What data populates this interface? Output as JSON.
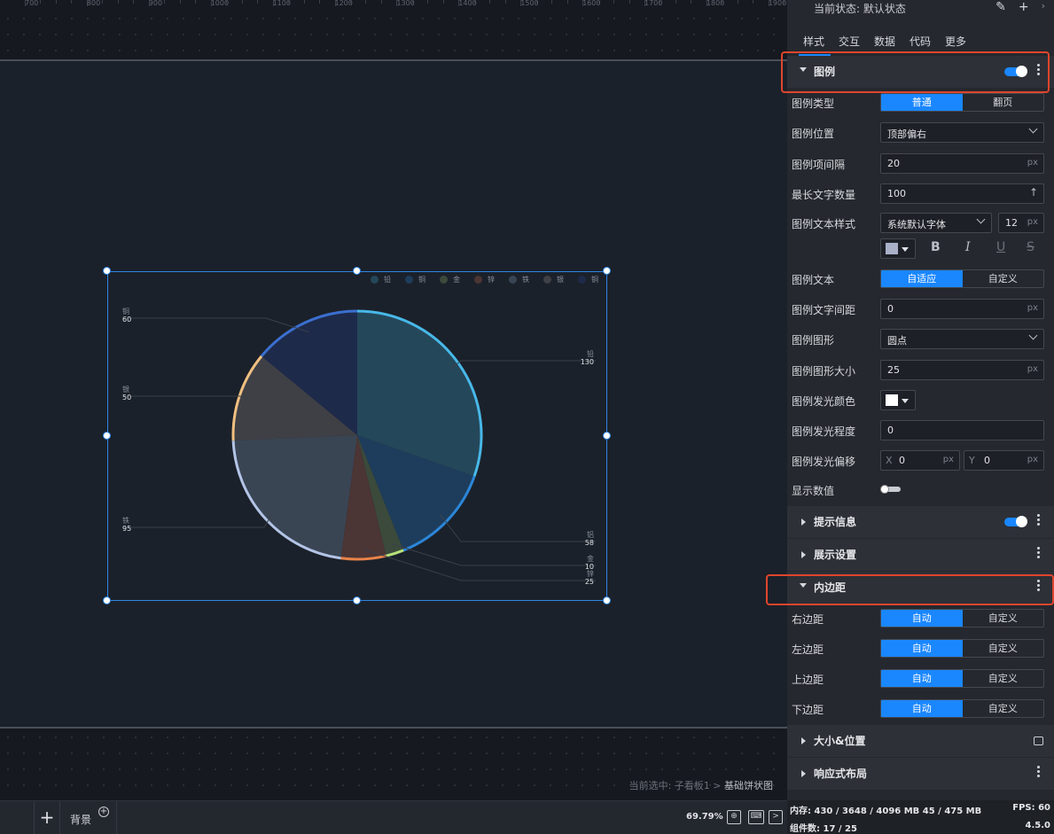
{
  "ruler": {
    "ticks": [
      "700",
      "800",
      "900",
      "1000",
      "1100",
      "1200",
      "1300",
      "1400",
      "1500",
      "1600",
      "1700",
      "1800",
      "1900"
    ]
  },
  "chart_data": {
    "type": "pie",
    "legend_position": "top-right",
    "legend": [
      "铅",
      "铜",
      "金",
      "锌",
      "铁",
      "银",
      "铜"
    ],
    "slices": [
      {
        "name": "铅",
        "value": 130,
        "color": "#48b8e8",
        "fill": "#25475a"
      },
      {
        "name": "铝",
        "value": 58,
        "color": "#2b86d8",
        "fill": "#1e3d5c"
      },
      {
        "name": "金",
        "value": 10,
        "color": "#b5e07a",
        "fill": "#3b4a3b"
      },
      {
        "name": "锌",
        "value": 25,
        "color": "#e8844a",
        "fill": "#4b3535"
      },
      {
        "name": "铁",
        "value": 95,
        "color": "#b3c4e6",
        "fill": "#3a4554"
      },
      {
        "name": "银",
        "value": 50,
        "color": "#f0c080",
        "fill": "#3f4046"
      },
      {
        "name": "铜",
        "value": 60,
        "color": "#3b6fd0",
        "fill": "#1e2a4a"
      }
    ],
    "labels": [
      {
        "name": "铅",
        "value": "130"
      },
      {
        "name": "铝",
        "value": "58"
      },
      {
        "name": "金",
        "value": "10"
      },
      {
        "name": "锌",
        "value": "25"
      },
      {
        "name": "铁",
        "value": "95"
      },
      {
        "name": "银",
        "value": "50"
      },
      {
        "name": "铜",
        "value": "60"
      }
    ]
  },
  "canvas": {
    "selection_prefix": "当前选中: 子看板1 >",
    "selection_name": "基础饼状图"
  },
  "bottom_bar": {
    "add": "+",
    "page_tab": "背景",
    "page_tab_add": "+",
    "zoom": "69.79%"
  },
  "panel": {
    "state": "当前状态: 默认状态",
    "tabs": [
      "样式",
      "交互",
      "数据",
      "代码",
      "更多"
    ],
    "legend_section": {
      "title": "图例",
      "type_label": "图例类型",
      "type_options": [
        "普通",
        "翻页"
      ],
      "position_label": "图例位置",
      "position_value": "顶部偏右",
      "gap_label": "图例项间隔",
      "gap_value": "20",
      "maxlen_label": "最长文字数量",
      "maxlen_value": "100",
      "text_style_label": "图例文本样式",
      "font_value": "系统默认字体",
      "font_size": "12",
      "text_color": "#a9b0c8",
      "text_label": "图例文本",
      "text_options": [
        "自适应",
        "自定义"
      ],
      "spacing_label": "图例文字间距",
      "spacing_value": "0",
      "shape_label": "图例图形",
      "shape_value": "圆点",
      "shape_size_label": "图例图形大小",
      "shape_size_value": "25",
      "glow_color_label": "图例发光颜色",
      "glow_color": "#ffffff",
      "glow_level_label": "图例发光程度",
      "glow_level_value": "0",
      "glow_offset_label": "图例发光偏移",
      "offset_x_label": "X",
      "offset_x": "0",
      "offset_y_label": "Y",
      "offset_y": "0",
      "show_value_label": "显示数值",
      "unit": "px"
    },
    "tooltip_title": "提示信息",
    "display_title": "展示设置",
    "padding_section": {
      "title": "内边距",
      "rows": [
        {
          "label": "右边距",
          "options": [
            "自动",
            "自定义"
          ]
        },
        {
          "label": "左边距",
          "options": [
            "自动",
            "自定义"
          ]
        },
        {
          "label": "上边距",
          "options": [
            "自动",
            "自定义"
          ]
        },
        {
          "label": "下边距",
          "options": [
            "自动",
            "自定义"
          ]
        }
      ]
    },
    "size_title": "大小&位置",
    "responsive_title": "响应式布局",
    "status": {
      "memory": "内存: 430 / 3648 / 4096 MB  45 / 475 MB",
      "fps": "FPS: 60",
      "components": "组件数: 17 / 25",
      "version": "4.5.0"
    }
  }
}
